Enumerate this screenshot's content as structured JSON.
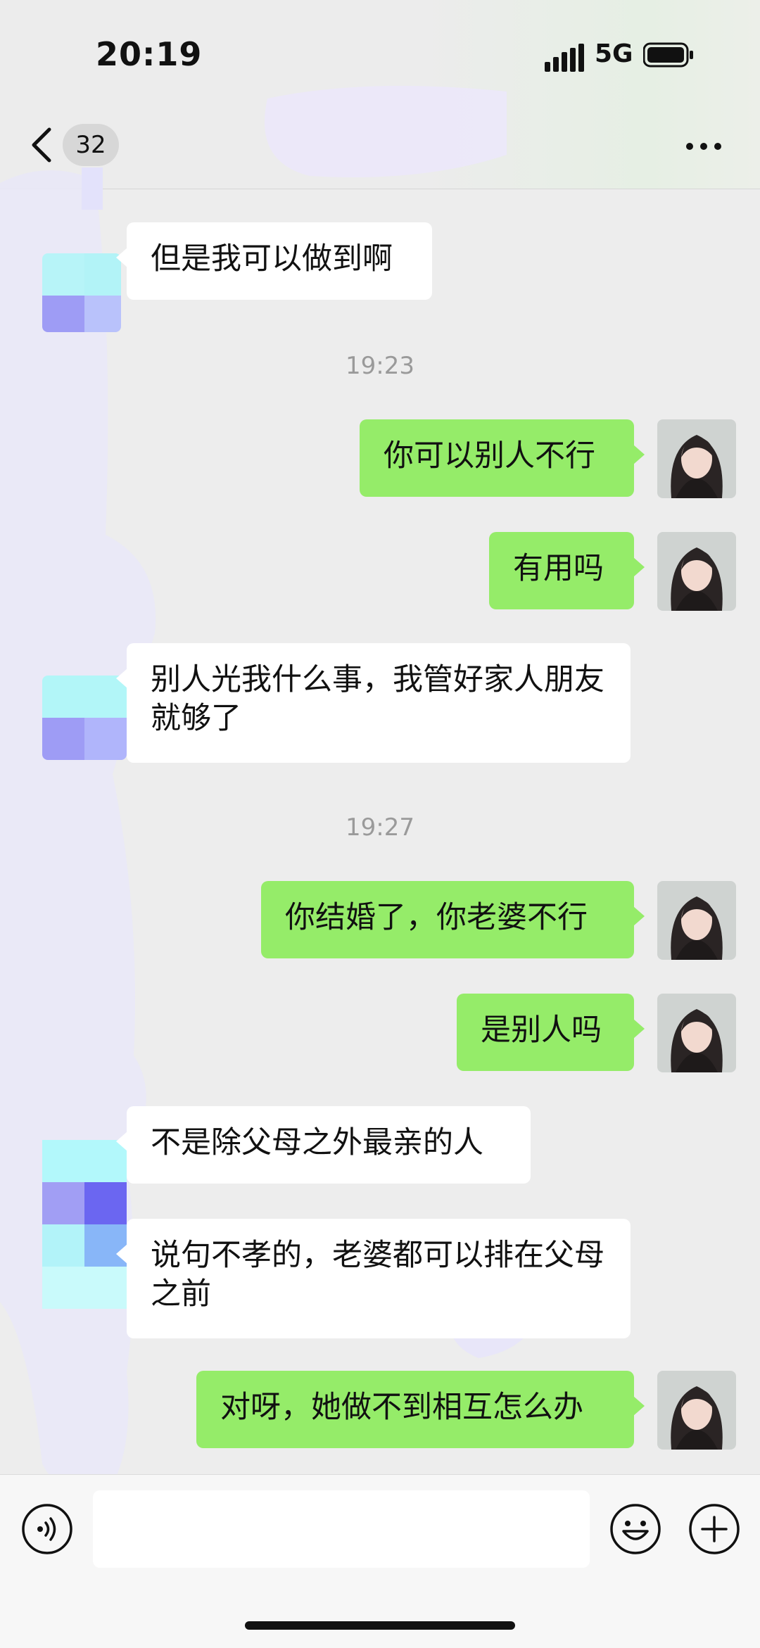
{
  "status_bar": {
    "time": "20:19",
    "network": "5G"
  },
  "header": {
    "unread_count": "32"
  },
  "messages": [
    {
      "type": "in",
      "text": "但是我可以做到啊"
    },
    {
      "type": "timestamp",
      "text": "19:23"
    },
    {
      "type": "out",
      "text": "你可以别人不行"
    },
    {
      "type": "out",
      "text": "有用吗"
    },
    {
      "type": "in",
      "text": "别人光我什么事，我管好家人朋友就够了"
    },
    {
      "type": "timestamp",
      "text": "19:27"
    },
    {
      "type": "out",
      "text": "你结婚了，你老婆不行"
    },
    {
      "type": "out",
      "text": "是别人吗"
    },
    {
      "type": "in",
      "text": "不是除父母之外最亲的人"
    },
    {
      "type": "in",
      "text": "说句不孝的，老婆都可以排在父母之前"
    },
    {
      "type": "out",
      "text": "对呀，她做不到相互怎么办"
    }
  ],
  "colors": {
    "outgoing_bubble": "#95ec69",
    "incoming_bubble": "#ffffff",
    "background": "#ededed"
  },
  "icons": [
    "back-chevron-icon",
    "more-icon",
    "voice-icon",
    "emoji-icon",
    "plus-icon",
    "signal-icon",
    "battery-icon"
  ]
}
